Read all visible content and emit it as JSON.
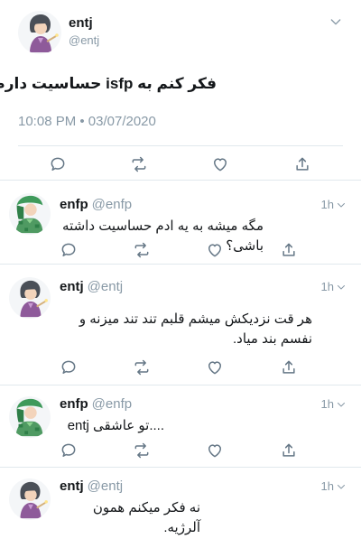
{
  "main_tweet": {
    "name": "entj",
    "handle": "@entj",
    "text": "فکر کنم به isfp حساسیت دارم",
    "timestamp": "10:08 PM • 03/07/2020",
    "actions": [
      "reply-icon",
      "retweet-icon",
      "like-icon",
      "share-icon"
    ]
  },
  "replies": [
    {
      "name": "enfp",
      "handle": "@enfp",
      "time": "1h",
      "text": "مگه میشه به یه ادم حساسیت داشته باشی؟"
    },
    {
      "name": "entj",
      "handle": "@entj",
      "time": "1h",
      "text": "هر قت نزدیکش میشم قلبم تند تند میزنه و نفسم بند میاد."
    },
    {
      "name": "enfp",
      "handle": "@enfp",
      "time": "1h",
      "text": "....تو عاشقی entj"
    },
    {
      "name": "entj",
      "handle": "@entj",
      "time": "1h",
      "text": "نه فکر میکنم همون آلرژیه."
    }
  ],
  "colors": {
    "muted": "#8899a6",
    "icon": "#657786",
    "divider": "#e1e8ed",
    "text": "#14171a"
  }
}
